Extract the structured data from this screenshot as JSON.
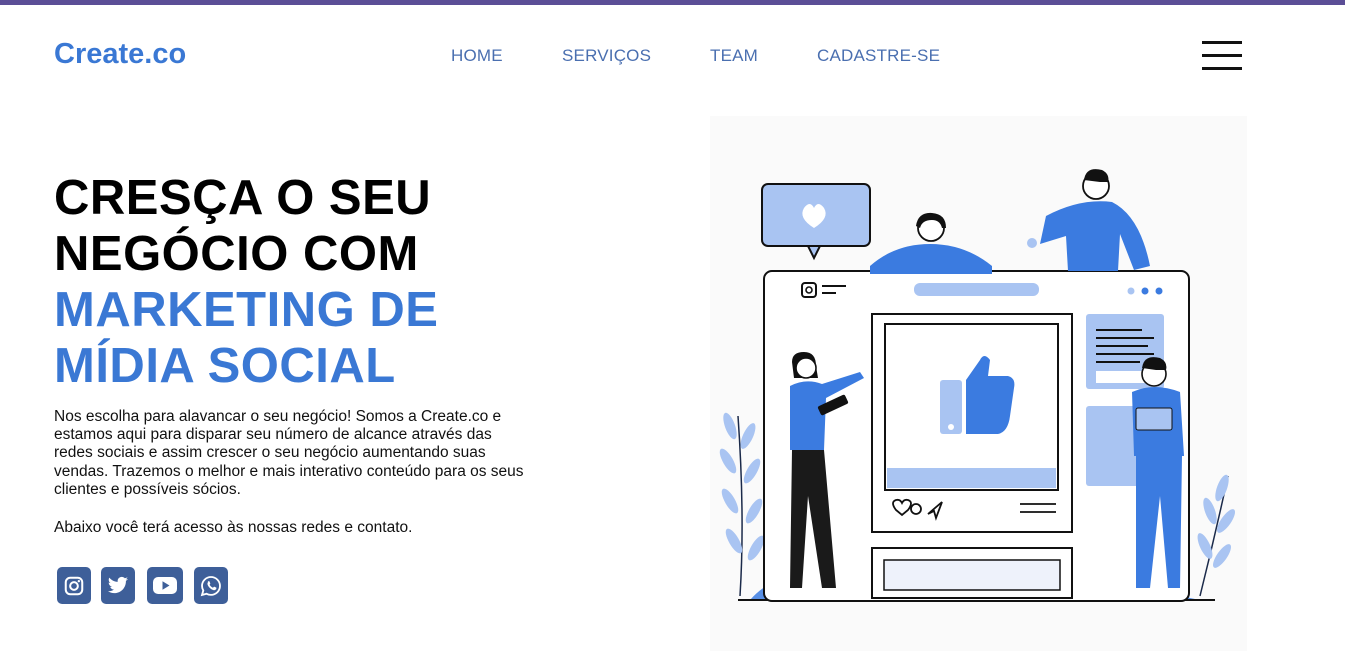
{
  "brand": {
    "logo": "Create.co"
  },
  "nav": {
    "items": [
      {
        "label": "HOME"
      },
      {
        "label": "SERVIÇOS"
      },
      {
        "label": "TEAM"
      },
      {
        "label": "CADASTRE-SE"
      }
    ],
    "menu_icon": "hamburger-menu-icon"
  },
  "hero": {
    "headline_line1": "CRESÇA O SEU",
    "headline_line2": "NEGÓCIO COM",
    "headline_line3": "MARKETING DE",
    "headline_line4": "MÍDIA SOCIAL",
    "description": "Nos escolha para alavancar o seu negócio! Somos a Create.co e estamos aqui para disparar seu número de alcance através das redes sociais e assim crescer o seu negócio aumentando suas vendas. Trazemos o melhor e mais interativo conteúdo para os seus clientes e possíveis sócios.",
    "description2": "Abaixo você terá acesso às nossas redes e contato."
  },
  "socials": [
    {
      "icon": "instagram-icon"
    },
    {
      "icon": "twitter-icon"
    },
    {
      "icon": "youtube-icon"
    },
    {
      "icon": "whatsapp-icon"
    }
  ],
  "colors": {
    "accent": "#3a78d4",
    "nav_text": "#4a6fb0",
    "social_bg": "#3e5f99",
    "top_bar": "#5b4e96",
    "illustration_blue": "#3b7be0",
    "illustration_light": "#a9c4f2"
  },
  "illustration": {
    "icon": "social-media-marketing-illustration"
  }
}
